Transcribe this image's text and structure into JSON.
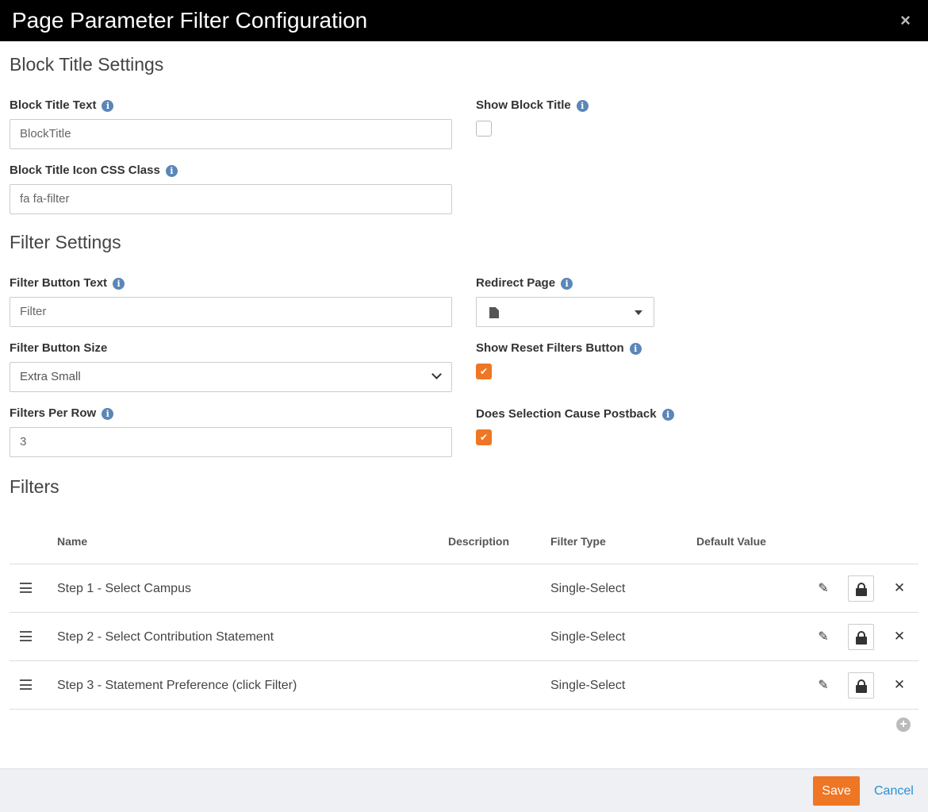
{
  "modal": {
    "title": "Page Parameter Filter Configuration",
    "close_glyph": "×"
  },
  "block_title_settings": {
    "heading": "Block Title Settings",
    "title_text_label": "Block Title Text",
    "title_text_value": "BlockTitle",
    "show_title_label": "Show Block Title",
    "show_title_checked": false,
    "icon_css_label": "Block Title Icon CSS Class",
    "icon_css_value": "fa fa-filter"
  },
  "filter_settings": {
    "heading": "Filter Settings",
    "button_text_label": "Filter Button Text",
    "button_text_value": "Filter",
    "redirect_label": "Redirect Page",
    "button_size_label": "Filter Button Size",
    "button_size_value": "Extra Small",
    "show_reset_label": "Show Reset Filters Button",
    "show_reset_checked": true,
    "per_row_label": "Filters Per Row",
    "per_row_value": "3",
    "postback_label": "Does Selection Cause Postback",
    "postback_checked": true
  },
  "filters": {
    "heading": "Filters",
    "columns": [
      "Name",
      "Description",
      "Filter Type",
      "Default Value"
    ],
    "rows": [
      {
        "name": "Step 1 - Select Campus",
        "description": "",
        "filter_type": "Single-Select",
        "default_value": ""
      },
      {
        "name": "Step 2 - Select Contribution Statement",
        "description": "",
        "filter_type": "Single-Select",
        "default_value": ""
      },
      {
        "name": "Step 3 - Statement Preference (click Filter)",
        "description": "",
        "filter_type": "Single-Select",
        "default_value": ""
      }
    ]
  },
  "footer": {
    "save_label": "Save",
    "cancel_label": "Cancel"
  },
  "colors": {
    "accent": "#ee7624",
    "info": "#5b86b8",
    "link": "#2a8fd6",
    "header_bg": "#000000"
  },
  "icons": {
    "info": "info-icon",
    "close": "close-icon",
    "drag": "drag-handle-icon",
    "edit": "pencil-icon",
    "security": "lock-icon",
    "delete": "times-icon",
    "add": "plus-circle-icon",
    "page": "file-icon"
  }
}
